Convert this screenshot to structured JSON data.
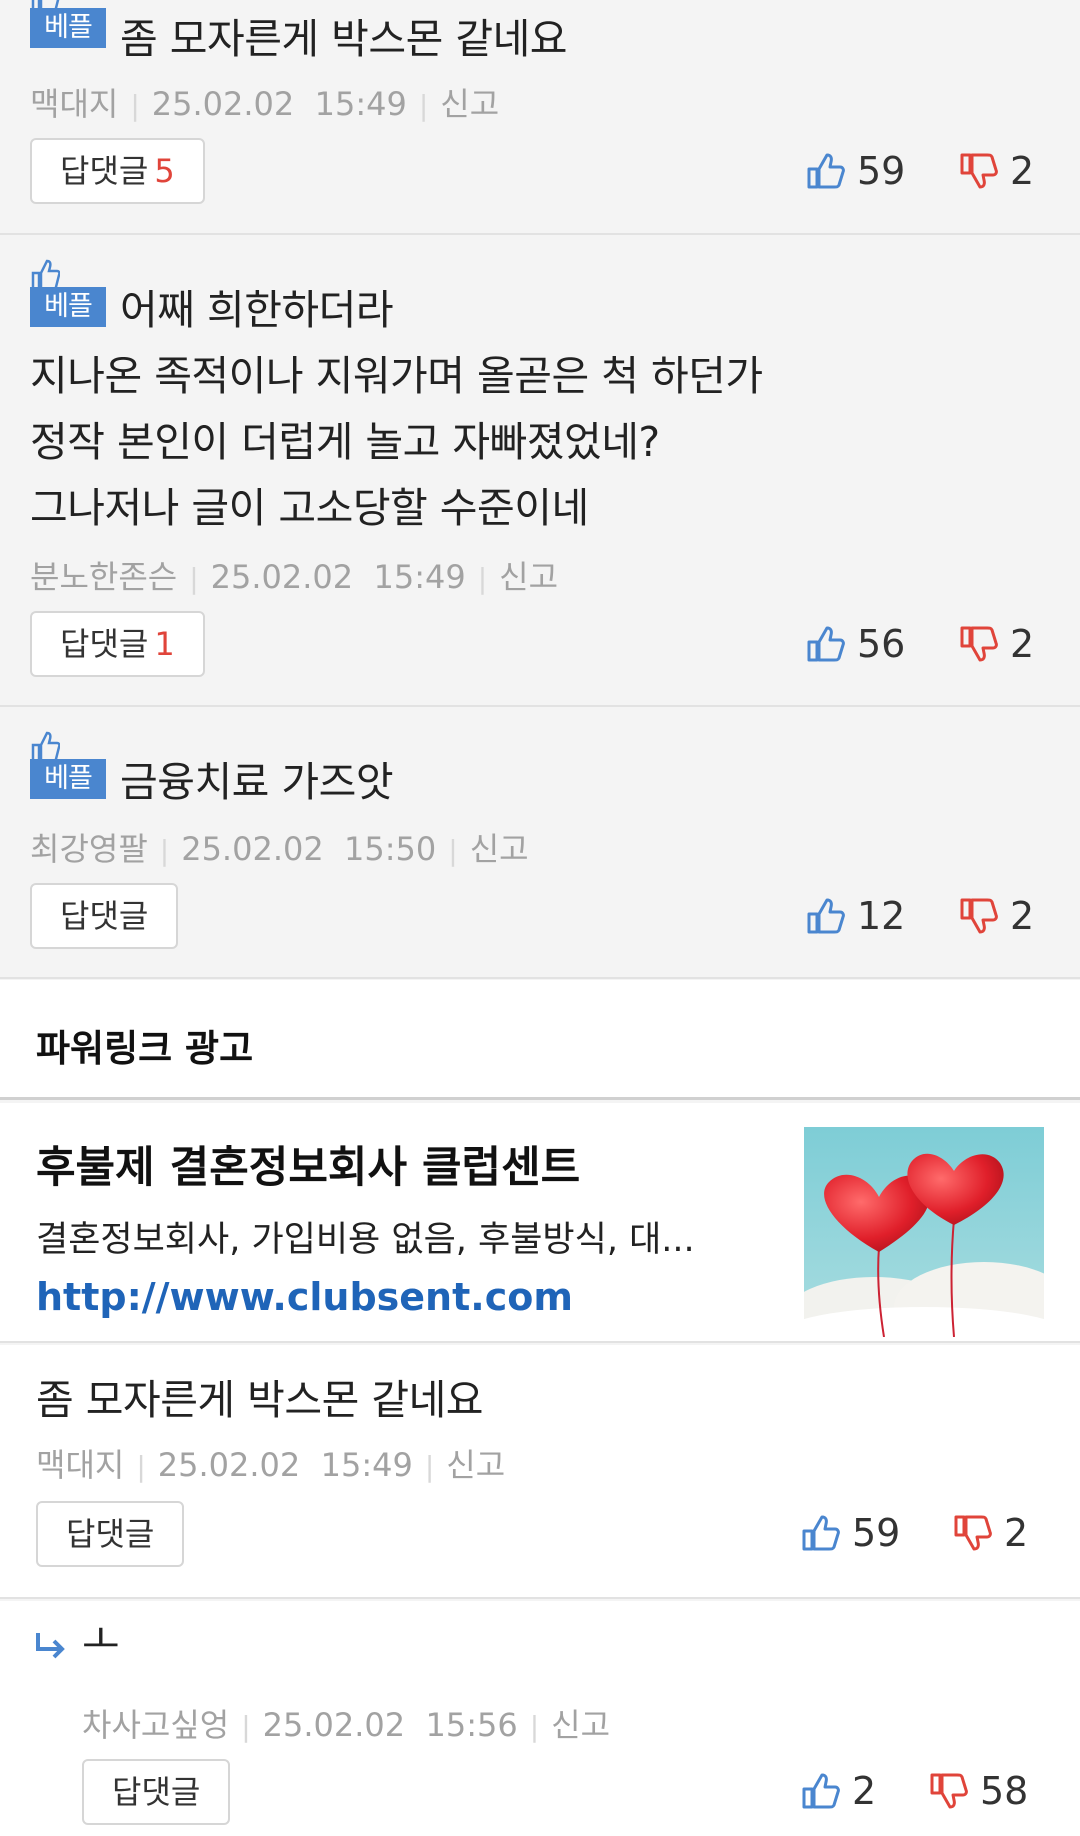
{
  "best_badge": "베플",
  "reply_label": "답댓글",
  "report_label": "신고",
  "comments": [
    {
      "lines": [
        "좀 모자른게 박스몬 같네요"
      ],
      "author": "맥대지",
      "date": "25.02.02",
      "time": "15:49",
      "reply_count": "5",
      "likes": "59",
      "dislikes": "2"
    },
    {
      "lines": [
        "어째 희한하더라",
        "지나온 족적이나 지워가며 올곧은 척 하던가",
        "정작 본인이 더럽게 놀고 자빠졌었네?",
        "그나저나 글이 고소당할 수준이네"
      ],
      "author": "분노한존슨",
      "date": "25.02.02",
      "time": "15:49",
      "reply_count": "1",
      "likes": "56",
      "dislikes": "2"
    },
    {
      "lines": [
        "금융치료 가즈앗"
      ],
      "author": "최강영팔",
      "date": "25.02.02",
      "time": "15:50",
      "reply_count": "",
      "likes": "12",
      "dislikes": "2"
    },
    {
      "lines": [
        "좀 모자른게 박스몬 같네요"
      ],
      "author": "맥대지",
      "date": "25.02.02",
      "time": "15:49",
      "reply_count": "",
      "likes": "59",
      "dislikes": "2"
    },
    {
      "lines": [
        "ㅗ"
      ],
      "author": "차사고싶엉",
      "date": "25.02.02",
      "time": "15:56",
      "reply_count": "",
      "likes": "2",
      "dislikes": "58"
    }
  ],
  "ad": {
    "header": "파워링크 광고",
    "title": "후불제 결혼정보회사 클럽센트",
    "description": "결혼정보회사, 가입비용 없음, 후불방식, 대...",
    "url": "http://www.clubsent.com"
  },
  "colors": {
    "best_badge": "#4a86cf",
    "reply_count": "#e0443a",
    "like_icon": "#4a86cf",
    "dislike_icon": "#e0443a",
    "ad_url": "#1f64b8"
  }
}
